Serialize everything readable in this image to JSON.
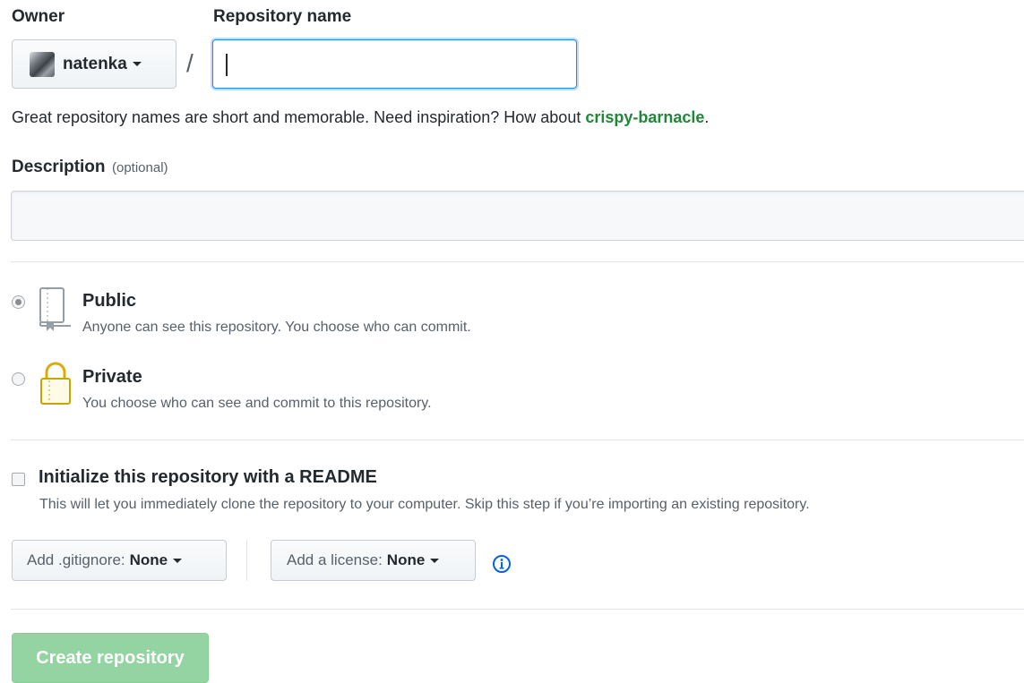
{
  "owner": {
    "label": "Owner",
    "value": "natenka"
  },
  "repo": {
    "label": "Repository name",
    "value": "",
    "separator": "/",
    "hint_prefix": "Great repository names are short and memorable. Need inspiration? How about ",
    "hint_suggestion": "crispy-barnacle",
    "hint_suffix": "."
  },
  "description": {
    "label": "Description",
    "optional": "(optional)",
    "value": ""
  },
  "visibility": {
    "public": {
      "title": "Public",
      "note": "Anyone can see this repository. You choose who can commit.",
      "checked": true
    },
    "private": {
      "title": "Private",
      "note": "You choose who can see and commit to this repository.",
      "checked": false
    }
  },
  "init": {
    "title": "Initialize this repository with a README",
    "note": "This will let you immediately clone the repository to your computer. Skip this step if you’re importing an existing repository.",
    "checked": false
  },
  "gitignore": {
    "label": "Add .gitignore:",
    "value": "None"
  },
  "license": {
    "label": "Add a license:",
    "value": "None"
  },
  "submit": {
    "label": "Create repository"
  },
  "colors": {
    "link": "#22863a",
    "primary_disabled": "#94d3a2",
    "focus": "#2188ff",
    "info": "#0366d6"
  }
}
